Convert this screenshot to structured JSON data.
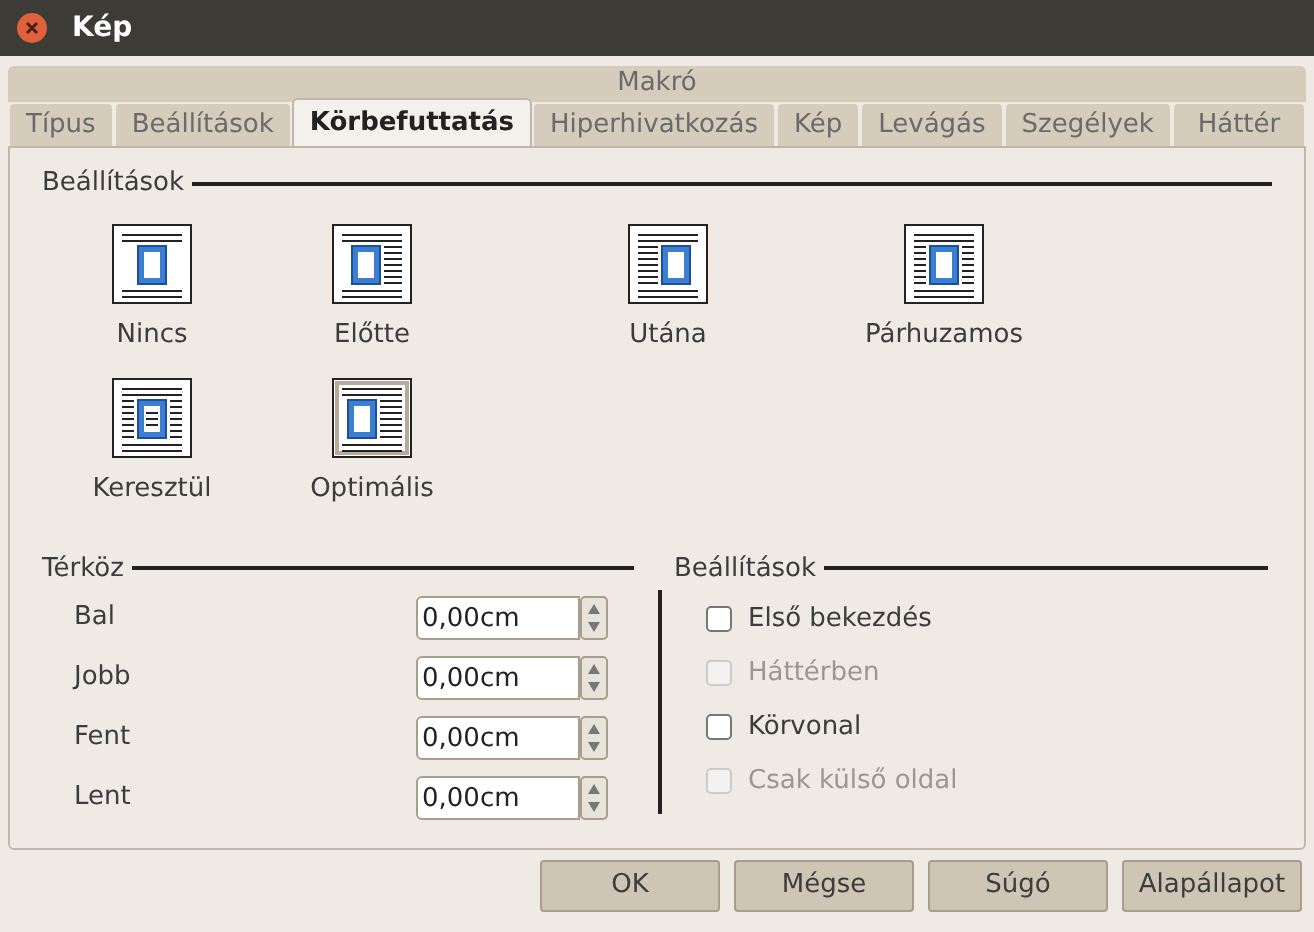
{
  "window": {
    "title": "Kép"
  },
  "tab_group": "Makró",
  "tabs": [
    {
      "label": "Típus",
      "selected": false
    },
    {
      "label": "Beállítások",
      "selected": false
    },
    {
      "label": "Körbefuttatás",
      "selected": true
    },
    {
      "label": "Hiperhivatkozás",
      "selected": false
    },
    {
      "label": "Kép",
      "selected": false
    },
    {
      "label": "Levágás",
      "selected": false
    },
    {
      "label": "Szegélyek",
      "selected": false
    },
    {
      "label": "Háttér",
      "selected": false
    }
  ],
  "wrap_section": {
    "title": "Beállítások",
    "options": [
      {
        "label": "Nincs",
        "kind": "none"
      },
      {
        "label": "Előtte",
        "kind": "before"
      },
      {
        "label": "Utána",
        "kind": "after"
      },
      {
        "label": "Párhuzamos",
        "kind": "parallel"
      },
      {
        "label": "Keresztül",
        "kind": "through"
      },
      {
        "label": "Optimális",
        "kind": "optimal"
      }
    ]
  },
  "spacing": {
    "title": "Térköz",
    "fields": [
      {
        "label": "Bal",
        "value": "0,00cm"
      },
      {
        "label": "Jobb",
        "value": "0,00cm"
      },
      {
        "label": "Fent",
        "value": "0,00cm"
      },
      {
        "label": "Lent",
        "value": "0,00cm"
      }
    ]
  },
  "options": {
    "title": "Beállítások",
    "items": [
      {
        "label": "Első bekezdés",
        "checked": false,
        "disabled": false
      },
      {
        "label": "Háttérben",
        "checked": false,
        "disabled": true
      },
      {
        "label": "Körvonal",
        "checked": false,
        "disabled": false
      },
      {
        "label": "Csak külső oldal",
        "checked": false,
        "disabled": true
      }
    ]
  },
  "buttons": [
    "OK",
    "Mégse",
    "Súgó",
    "Alapállapot"
  ]
}
